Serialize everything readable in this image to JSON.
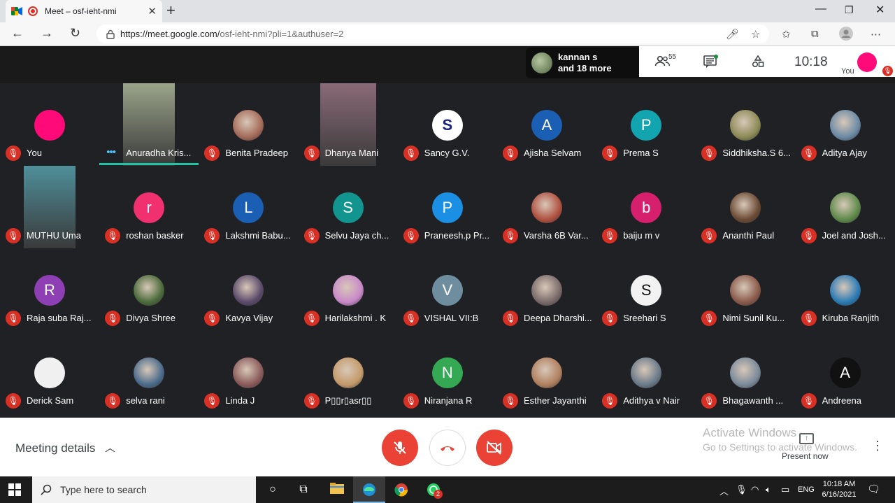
{
  "browser": {
    "tab_title": "Meet – osf-ieht-nmi",
    "url_host": "https://meet.google.com/",
    "url_path": "osf-ieht-nmi?pli=1&authuser=2"
  },
  "meet": {
    "presenter_line1": "kannan s",
    "presenter_line2": "and 18 more",
    "participants_count": "55",
    "time": "10:18",
    "self_label": "You",
    "self_color": "#ff0a78"
  },
  "tiles": [
    {
      "name": "You",
      "type": "avatar",
      "letter": "",
      "color": "#ff0a78"
    },
    {
      "name": "Anuradha Kris...",
      "type": "video",
      "speaking": true,
      "color": "#9aa48a"
    },
    {
      "name": "Benita Pradeep",
      "type": "photo",
      "letter": "",
      "color": "#a56b5a"
    },
    {
      "name": "Dhanya Mani",
      "type": "video",
      "color": "#8a6a78"
    },
    {
      "name": "Sancy G.V.",
      "type": "photo",
      "letter": "S",
      "color": "#1a237e"
    },
    {
      "name": "Ajisha Selvam",
      "type": "avatar",
      "letter": "A",
      "color": "#1a5fb4"
    },
    {
      "name": "Prema S",
      "type": "avatar",
      "letter": "P",
      "color": "#12a4af"
    },
    {
      "name": "Siddhiksha.S 6...",
      "type": "photo",
      "letter": "",
      "color": "#8c8a56"
    },
    {
      "name": "Aditya Ajay",
      "type": "photo",
      "letter": "",
      "color": "#6b8aa5"
    },
    {
      "name": "MUTHU Uma",
      "type": "video",
      "color": "#4f8f9a"
    },
    {
      "name": "roshan basker",
      "type": "avatar",
      "letter": "r",
      "color": "#f0306f"
    },
    {
      "name": "Lakshmi Babu...",
      "type": "avatar",
      "letter": "L",
      "color": "#1a5fb4"
    },
    {
      "name": "Selvu Jaya ch...",
      "type": "avatar",
      "letter": "S",
      "color": "#12958f"
    },
    {
      "name": "Praneesh.p Pr...",
      "type": "avatar",
      "letter": "P",
      "color": "#1a8fe3"
    },
    {
      "name": "Varsha 6B Var...",
      "type": "photo",
      "letter": "",
      "color": "#b05040"
    },
    {
      "name": "baiju m v",
      "type": "avatar",
      "letter": "b",
      "color": "#d6206e"
    },
    {
      "name": "Ananthi Paul",
      "type": "photo",
      "letter": "",
      "color": "#6a4a35"
    },
    {
      "name": "Joel and Josh...",
      "type": "photo",
      "letter": "",
      "color": "#5e8a4a"
    },
    {
      "name": "Raja suba Raj...",
      "type": "avatar",
      "letter": "R",
      "color": "#8e3fb3"
    },
    {
      "name": "Divya Shree",
      "type": "photo",
      "letter": "",
      "color": "#4a6a3a"
    },
    {
      "name": "Kavya Vijay",
      "type": "photo",
      "letter": "",
      "color": "#5a4a6a"
    },
    {
      "name": "Harilakshmi . K",
      "type": "photo",
      "letter": "",
      "color": "#c888c8"
    },
    {
      "name": "VISHAL VII:B",
      "type": "avatar",
      "letter": "V",
      "color": "#6e8ea0"
    },
    {
      "name": "Deepa Dharshi...",
      "type": "photo",
      "letter": "",
      "color": "#7a6a6a"
    },
    {
      "name": "Sreehari S",
      "type": "photo",
      "letter": "S",
      "color": "#f2f2f2"
    },
    {
      "name": "Nimi Sunil Ku...",
      "type": "photo",
      "letter": "",
      "color": "#8a5a4a"
    },
    {
      "name": "Kiruba Ranjith",
      "type": "photo",
      "letter": "",
      "color": "#2a7ab5"
    },
    {
      "name": "Derick Sam",
      "type": "photo",
      "letter": "",
      "color": "#f0f0f0"
    },
    {
      "name": "selva rani",
      "type": "photo",
      "letter": "",
      "color": "#4a6a8a"
    },
    {
      "name": "Linda J",
      "type": "photo",
      "letter": "",
      "color": "#8a5a5a"
    },
    {
      "name": "P▯▯r▯asr▯▯",
      "type": "photo",
      "letter": "",
      "color": "#c49a6a"
    },
    {
      "name": "Niranjana R",
      "type": "avatar",
      "letter": "N",
      "color": "#34a853"
    },
    {
      "name": "Esther Jayanthi",
      "type": "photo",
      "letter": "",
      "color": "#b08060"
    },
    {
      "name": "Adithya v Nair",
      "type": "photo",
      "letter": "",
      "color": "#6a7a8a"
    },
    {
      "name": "Bhagawanth ...",
      "type": "photo",
      "letter": "",
      "color": "#7a8a9a"
    },
    {
      "name": "Andreena",
      "type": "avatar",
      "letter": "A",
      "color": "#111111"
    }
  ],
  "bottom": {
    "meeting_details": "Meeting details",
    "activate_line1": "Activate Windows",
    "activate_line2": "Go to Settings to activate Windows.",
    "present_now": "Present now",
    "end_call_color": "#ea4335"
  },
  "taskbar": {
    "search_placeholder": "Type here to search",
    "lang": "ENG",
    "clock_time": "10:18 AM",
    "clock_date": "6/16/2021",
    "whatsapp_badge": "2"
  }
}
